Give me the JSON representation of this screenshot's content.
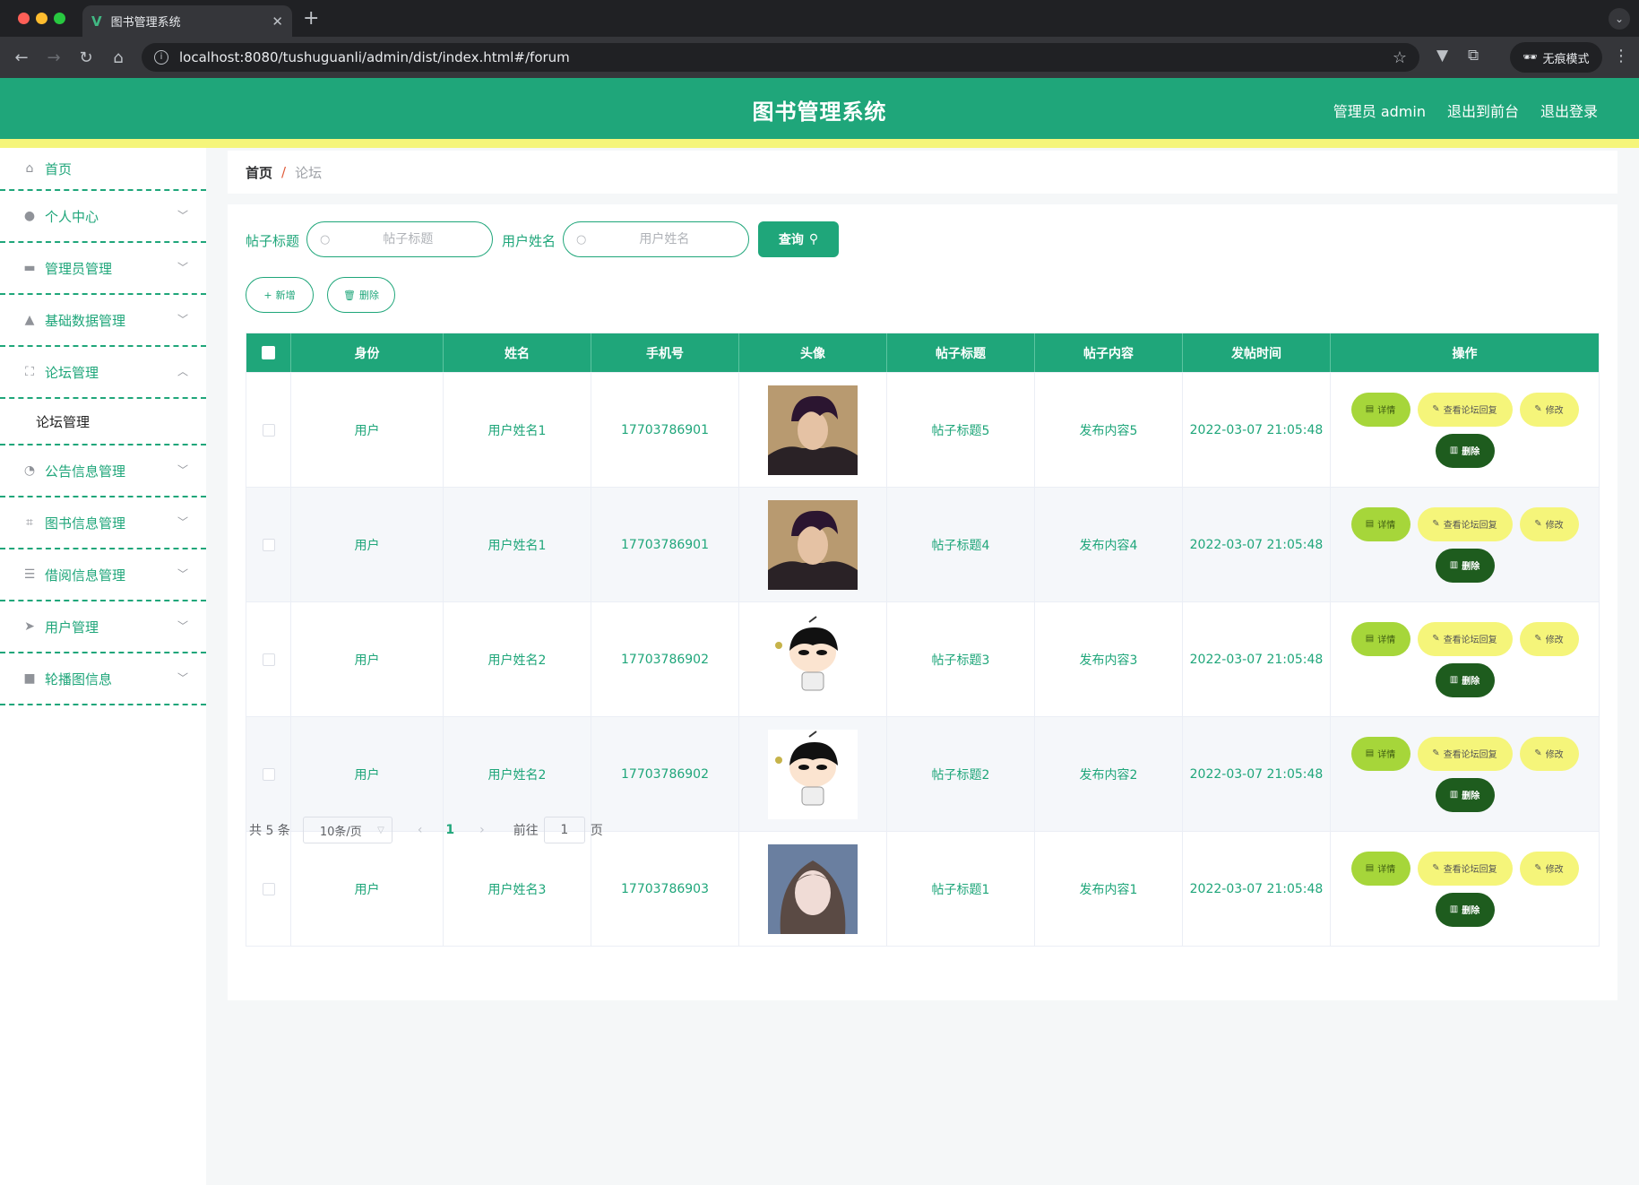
{
  "browser": {
    "tab_title": "图书管理系统",
    "url": "localhost:8080/tushuguanli/admin/dist/index.html#/forum",
    "incognito_label": "无痕模式"
  },
  "header": {
    "title": "图书管理系统",
    "user_label": "管理员 admin",
    "front_label": "退出到前台",
    "logout_label": "退出登录"
  },
  "sidebar": {
    "home": "首页",
    "items": [
      {
        "label": "个人中心",
        "icon": "user-icon"
      },
      {
        "label": "管理员管理",
        "icon": "desktop-icon"
      },
      {
        "label": "基础数据管理",
        "icon": "user-solid-icon"
      },
      {
        "label": "论坛管理",
        "icon": "full-screen-icon"
      },
      {
        "label": "公告信息管理",
        "icon": "odometer-icon"
      },
      {
        "label": "图书信息管理",
        "icon": "crop-icon"
      },
      {
        "label": "借阅信息管理",
        "icon": "list-icon"
      },
      {
        "label": "用户管理",
        "icon": "send-icon"
      },
      {
        "label": "轮播图信息",
        "icon": "video-camera-icon"
      }
    ],
    "submenu": "论坛管理"
  },
  "breadcrumb": {
    "home": "首页",
    "sep": "/",
    "current": "论坛"
  },
  "search": {
    "title_label": "帖子标题",
    "title_placeholder": "帖子标题",
    "name_label": "用户姓名",
    "name_placeholder": "用户姓名",
    "query_label": "查询"
  },
  "actions": {
    "add_label": "新增",
    "delete_label": "删除"
  },
  "table": {
    "headers": [
      "身份",
      "姓名",
      "手机号",
      "头像",
      "帖子标题",
      "帖子内容",
      "发帖时间",
      "操作"
    ],
    "rows": [
      {
        "role": "用户",
        "name": "用户姓名1",
        "phone": "17703786901",
        "avatar": "male-avatar",
        "title": "帖子标题5",
        "content": "发布内容5",
        "time": "2022-03-07 21:05:48"
      },
      {
        "role": "用户",
        "name": "用户姓名1",
        "phone": "17703786901",
        "avatar": "male-avatar",
        "title": "帖子标题4",
        "content": "发布内容4",
        "time": "2022-03-07 21:05:48"
      },
      {
        "role": "用户",
        "name": "用户姓名2",
        "phone": "17703786902",
        "avatar": "cartoon-avatar",
        "title": "帖子标题3",
        "content": "发布内容3",
        "time": "2022-03-07 21:05:48"
      },
      {
        "role": "用户",
        "name": "用户姓名2",
        "phone": "17703786902",
        "avatar": "cartoon-avatar",
        "title": "帖子标题2",
        "content": "发布内容2",
        "time": "2022-03-07 21:05:48"
      },
      {
        "role": "用户",
        "name": "用户姓名3",
        "phone": "17703786903",
        "avatar": "female-avatar",
        "title": "帖子标题1",
        "content": "发布内容1",
        "time": "2022-03-07 21:05:48"
      }
    ],
    "ops": {
      "detail": "详情",
      "reply": "查看论坛回复",
      "edit": "修改",
      "delete": "删除"
    }
  },
  "pagination": {
    "total": "共 5 条",
    "page_size": "10条/页",
    "current_page": "1",
    "goto_label": "前往",
    "goto_value": "1",
    "page_unit": "页"
  },
  "colors": {
    "primary": "#1fa67a",
    "accent_yellow": "#f5f57a",
    "detail_green": "#a6d63a",
    "delete_dark": "#1e5c1e"
  }
}
